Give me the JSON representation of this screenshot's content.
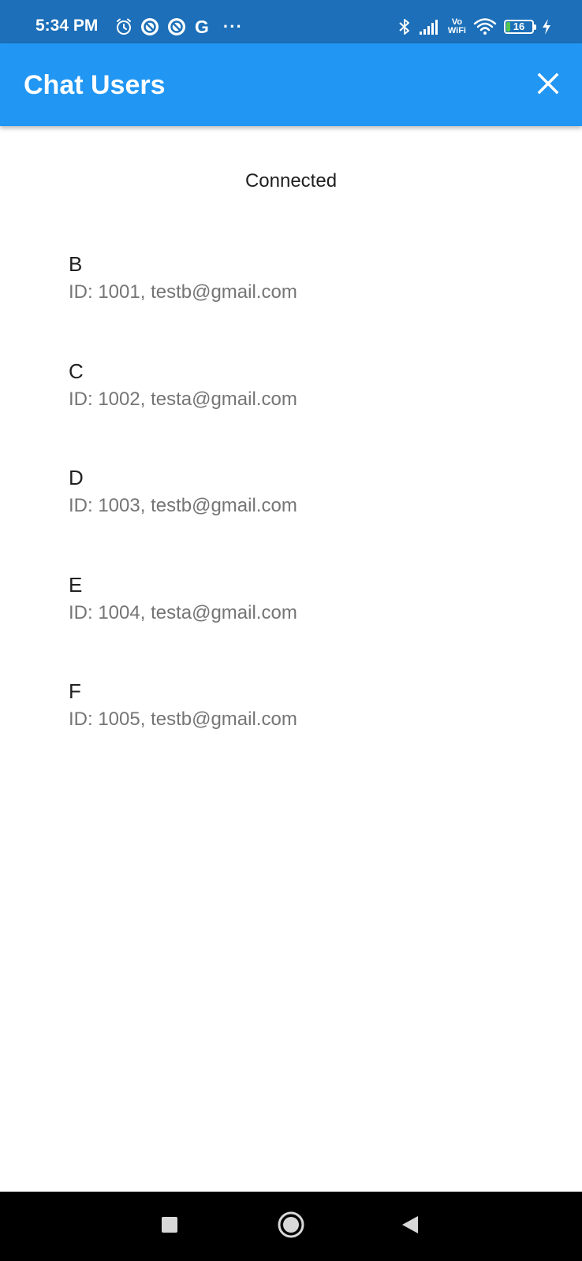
{
  "status_bar": {
    "time": "5:34 PM",
    "left_icons": [
      "alarm-icon",
      "circle-notification-icon",
      "circle-notification-icon",
      "google-icon",
      "more-dots-icon"
    ],
    "google_letter": "G",
    "dots": "···",
    "right_icons": [
      "bluetooth-icon",
      "signal-icon",
      "vowifi-icon",
      "wifi-icon",
      "battery-icon",
      "charging-icon"
    ],
    "vowifi_top": "Vo",
    "vowifi_bottom": "WiFi",
    "battery_level": "16",
    "background_color": "#1c6fb8"
  },
  "app_bar": {
    "title": "Chat Users",
    "close_icon": "close-icon",
    "background_color": "#2196f3"
  },
  "main": {
    "connection_status": "Connected",
    "users": [
      {
        "name": "B",
        "detail": "ID: 1001, testb@gmail.com"
      },
      {
        "name": "C",
        "detail": "ID: 1002, testa@gmail.com"
      },
      {
        "name": "D",
        "detail": "ID: 1003, testb@gmail.com"
      },
      {
        "name": "E",
        "detail": "ID: 1004, testa@gmail.com"
      },
      {
        "name": "F",
        "detail": "ID: 1005, testb@gmail.com"
      }
    ]
  },
  "nav_bar": {
    "buttons": [
      "recent-apps-icon",
      "home-icon",
      "back-icon"
    ]
  }
}
